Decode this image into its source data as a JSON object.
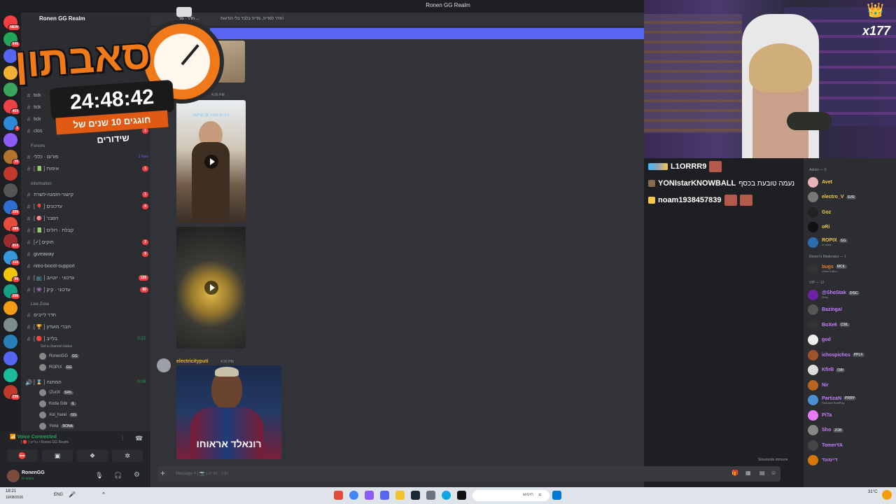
{
  "window": {
    "title": "Ronen GG Realm"
  },
  "server_rail": {
    "servers": [
      {
        "badge": "NEW",
        "color": "#f23f43"
      },
      {
        "badge": "545",
        "color": "#23a559"
      },
      {
        "badge": "",
        "color": "#5865f2"
      },
      {
        "badge": "",
        "color": "#f0b232"
      },
      {
        "badge": "",
        "color": "#3ba55c"
      },
      {
        "badge": "403",
        "color": "#ed4245"
      },
      {
        "badge": "1",
        "color": "#2b8ad8"
      },
      {
        "badge": "",
        "color": "#8b5cf6"
      },
      {
        "badge": "15",
        "color": "#b1752e"
      },
      {
        "badge": "",
        "color": "#c0392b"
      },
      {
        "badge": "",
        "color": "#555"
      },
      {
        "badge": "159",
        "color": "#2f6fd1"
      },
      {
        "badge": "188",
        "color": "#e74c3c"
      },
      {
        "badge": "913",
        "color": "#9b2c2c"
      },
      {
        "badge": "115",
        "color": "#3498db"
      },
      {
        "badge": "99",
        "color": "#f1c40f"
      },
      {
        "badge": "208",
        "color": "#16a085"
      },
      {
        "badge": "",
        "color": "#f39c12"
      },
      {
        "badge": "",
        "color": "#7f8c8d"
      },
      {
        "badge": "",
        "color": "#2980b9"
      },
      {
        "badge": "",
        "color": "#5865f2"
      },
      {
        "badge": "",
        "color": "#1abc9c"
      },
      {
        "badge": "239",
        "color": "#c0392b"
      }
    ]
  },
  "sidebar": {
    "server_name": "Ronen GG Realm",
    "channels_top": [
      {
        "label": "tick",
        "badge": ""
      },
      {
        "label": "tick",
        "badge": ""
      },
      {
        "label": "tick",
        "badge": ""
      },
      {
        "label": "clos",
        "badge": "1"
      }
    ],
    "forums_category": "Forums",
    "forums": [
      {
        "label": "פורום · כללי",
        "badge": "1 New"
      },
      {
        "label": "[ 📗 ] אימות",
        "badge": "1"
      }
    ],
    "info_category": "information",
    "info_channels": [
      {
        "label": "קישור-הזמנה-לשרת",
        "badge": "1"
      },
      {
        "label": "[ 🎈 ] עדכונים",
        "badge": "4"
      },
      {
        "label": "[ 🎯 ] הסבר",
        "badge": ""
      },
      {
        "label": "[ 📗 ] קבלת · רולים",
        "badge": ""
      },
      {
        "label": "[✓] חוקים",
        "badge": "2"
      },
      {
        "label": "giveaway",
        "badge": "9"
      },
      {
        "label": "nitro-boost-support",
        "badge": ""
      },
      {
        "label": "[ 📺 ] עדכוני · יוטיוב",
        "badge": "129"
      },
      {
        "label": "[ 👾 ] עדכוני · קיק",
        "badge": "89"
      }
    ],
    "live_category": "Live Zone",
    "live_channels": [
      {
        "label": "חדר לייבים",
        "time": ""
      },
      {
        "label": "[ 🏆 ] חברי מועדון",
        "time": ""
      },
      {
        "label": "[ 🔴 ] בלייב",
        "time": "0:22"
      }
    ],
    "live_status": "Set a channel status",
    "live_users": [
      {
        "name": "RonenGG",
        "tag": "GG"
      },
      {
        "name": "ROPIX",
        "tag": "GG"
      }
    ],
    "waiting_channel": {
      "label": "[ ⌛ ] המתנה",
      "time": "0:09"
    },
    "waiting_users": [
      {
        "name": "!ZuriX",
        "tag": "SRIL"
      },
      {
        "name": "Koda Gibi",
        "tag": "IL"
      },
      {
        "name": "Xol_harel",
        "tag": "GG"
      },
      {
        "name": "Yona",
        "tag": "RONA"
      }
    ]
  },
  "voice_panel": {
    "status": "Voice Connected",
    "location": "[ 🔴 ] בלייב / Ronen GG Realm"
  },
  "user_panel": {
    "name": "RonenGG",
    "status": "In voice"
  },
  "chat": {
    "channel_title": "חדר · מד ...",
    "channel_topic": "חדר למדיה, מדיה בלבד בלי הודעות!",
    "time1": "4:26 PM",
    "message_author": "electricityputi",
    "message_time": "4:26 PM",
    "video1_caption": "בירים מגיע 😡 קחשון",
    "image_caption": "רונאלד אראוחו",
    "slowmode": "Slowmode immune",
    "composer_placeholder": "Message # | 📷 | חדר · מדיה"
  },
  "subathon": {
    "title": "סאבתון",
    "timer": "24:48:42",
    "subtitle": "חוגגים 10 שנים של שידורים"
  },
  "stream_chat": [
    {
      "user": "L1ORRR9",
      "text": ""
    },
    {
      "user": "YONIstarKNOWBALL",
      "text": "נעמה טובעת בכסף"
    },
    {
      "user": "noam1938457839",
      "text": ""
    }
  ],
  "webcam": {
    "overlay_tag": "x177"
  },
  "members": {
    "sections": [
      {
        "title": "Admin — 5",
        "members": [
          {
            "name": "Avet",
            "tag": "",
            "sub": "",
            "color": "#f2c94c",
            "avatar": "#e8b4b8"
          },
          {
            "name": "electro_V",
            "tag": "SVR",
            "sub": "",
            "color": "#f2c94c",
            "avatar": "#777"
          },
          {
            "name": "Goz",
            "tag": "",
            "sub": "",
            "color": "#f2c94c",
            "avatar": "#222"
          },
          {
            "name": "oRi",
            "tag": "",
            "sub": "",
            "color": "#f2c94c",
            "avatar": "#111"
          },
          {
            "name": "ROPIX",
            "tag": "GG",
            "sub": "In voice",
            "color": "#f2c94c",
            "avatar": "#2b6cb0"
          }
        ]
      },
      {
        "title": "Ronen's Moderator — 1",
        "members": [
          {
            "name": "bugs",
            "tag": "MCIL",
            "sub": "Video Editor...",
            "color": "#e67e22",
            "avatar": "#333"
          }
        ]
      },
      {
        "title": "VIP — 12",
        "members": [
          {
            "name": "@ShoStak",
            "tag": "DISC",
            "sub": "2Key",
            "color": "#c77dff",
            "avatar": "#6b21a8"
          },
          {
            "name": "Bazinga!",
            "tag": "",
            "sub": "",
            "color": "#c77dff",
            "avatar": "#555"
          },
          {
            "name": "BoXe6",
            "tag": "CSIL",
            "sub": "",
            "color": "#c77dff",
            "avatar": "#333"
          },
          {
            "name": "god",
            "tag": "",
            "sub": "",
            "color": "#c77dff",
            "avatar": "#eee"
          },
          {
            "name": "ichospichos",
            "tag": "PPLX",
            "sub": "",
            "color": "#c77dff",
            "avatar": "#a0522d"
          },
          {
            "name": "KfirB",
            "tag": "OAI",
            "sub": "",
            "color": "#c77dff",
            "avatar": "#ddd"
          },
          {
            "name": "Nir",
            "tag": "",
            "sub": "",
            "color": "#c77dff",
            "avatar": "#b5651d"
          },
          {
            "name": "PartizaN",
            "tag": "PRRP",
            "sub": "PartizaN RolePlay",
            "color": "#c77dff",
            "avatar": "#4a90d9"
          },
          {
            "name": "PiTa",
            "tag": "",
            "sub": "",
            "color": "#c77dff",
            "avatar": "#e879f9"
          },
          {
            "name": "Sho",
            "tag": "ZOB",
            "sub": "",
            "color": "#c77dff",
            "avatar": "#888"
          },
          {
            "name": "TomerYA",
            "tag": "",
            "sub": "",
            "color": "#c77dff",
            "avatar": "#444"
          },
          {
            "name": "דיימונד",
            "tag": "",
            "sub": "",
            "color": "#c77dff",
            "avatar": "#d97706"
          }
        ]
      }
    ]
  },
  "taskbar": {
    "time": "18:21",
    "date": "10/08/2026",
    "lang": "ENG",
    "search_placeholder": "חיפוש",
    "weather": "31°C"
  }
}
